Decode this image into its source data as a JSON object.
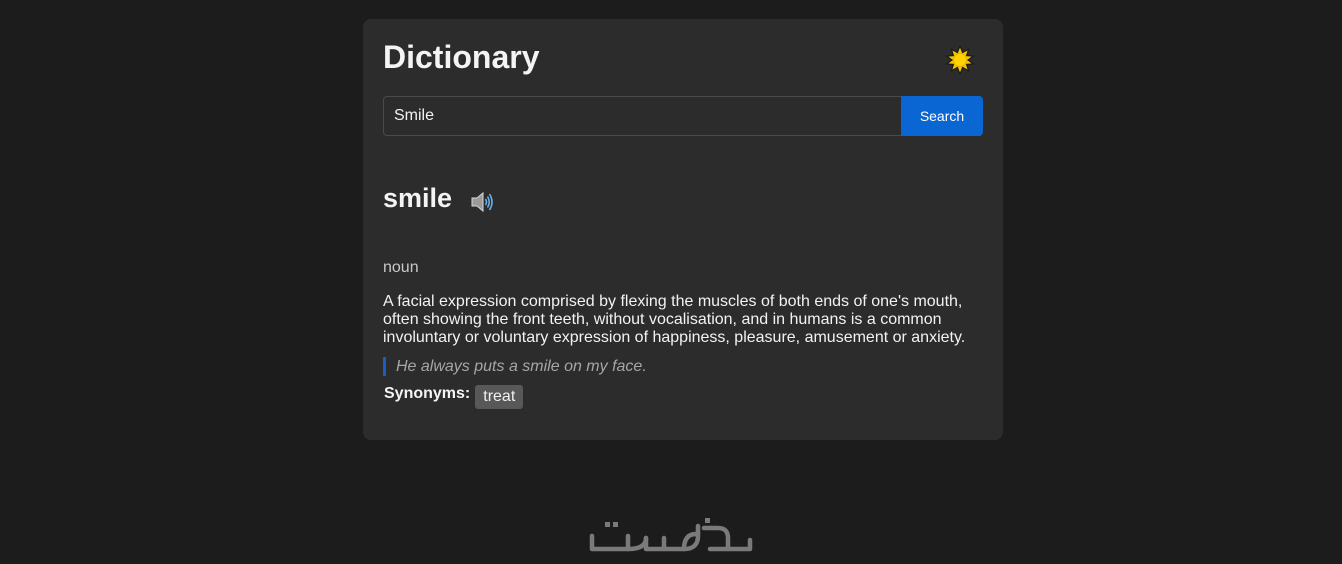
{
  "header": {
    "title": "Dictionary",
    "theme_toggle_icon": "sun-icon"
  },
  "search": {
    "value": "Smile",
    "placeholder": "",
    "button_label": "Search"
  },
  "entry": {
    "word": "smile",
    "audio_icon": "speaker-icon",
    "part_of_speech": "noun",
    "definition": "A facial expression comprised by flexing the muscles of both ends of one's mouth, often showing the front teeth, without vocalisation, and in humans is a common involuntary or voluntary expression of happiness, pleasure, amusement or anxiety.",
    "example": "He always puts a smile on my face.",
    "synonyms_label": "Synonyms:",
    "synonyms": [
      "treat"
    ]
  },
  "watermark": {
    "text": "خمسات"
  },
  "colors": {
    "background": "#1c1c1c",
    "card": "#2c2c2c",
    "accent": "#0a66d2",
    "example_border": "#1a5cc0",
    "chip": "#585858"
  }
}
